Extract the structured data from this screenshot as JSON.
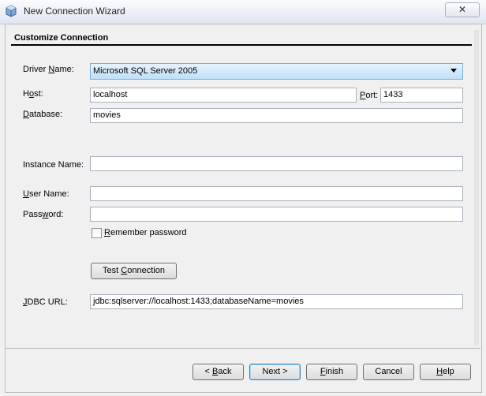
{
  "window": {
    "title": "New Connection Wizard",
    "close_symbol": "✕"
  },
  "section": {
    "title": "Customize Connection"
  },
  "form": {
    "driver": {
      "label_pre": "Driver ",
      "label_ul": "N",
      "label_post": "ame:",
      "value": "Microsoft SQL Server 2005"
    },
    "host": {
      "label_pre": "H",
      "label_ul": "o",
      "label_post": "st:",
      "value": "localhost"
    },
    "port": {
      "label_pre": "",
      "label_ul": "P",
      "label_post": "ort:",
      "value": "1433"
    },
    "database": {
      "label_pre": "",
      "label_ul": "D",
      "label_post": "atabase:",
      "value": "movies"
    },
    "instance": {
      "label": "Instance Name:",
      "value": ""
    },
    "user": {
      "label_pre": "",
      "label_ul": "U",
      "label_post": "ser Name:",
      "value": ""
    },
    "password": {
      "label_pre": "Pass",
      "label_ul": "w",
      "label_post": "ord:",
      "value": ""
    },
    "remember": {
      "label_pre": "",
      "label_ul": "R",
      "label_post": "emember password",
      "checked": false
    },
    "test_button": {
      "label_pre": "Test ",
      "label_ul": "C",
      "label_post": "onnection"
    },
    "jdbc": {
      "label_pre": "",
      "label_ul": "J",
      "label_post": "DBC URL:",
      "value": "jdbc:sqlserver://localhost:1433;databaseName=movies"
    }
  },
  "footer": {
    "back": {
      "label_pre": "< ",
      "label_ul": "B",
      "label_post": "ack"
    },
    "next": {
      "label": "Next >"
    },
    "finish": {
      "label_pre": "",
      "label_ul": "F",
      "label_post": "inish"
    },
    "cancel": {
      "label": "Cancel"
    },
    "help": {
      "label_pre": "",
      "label_ul": "H",
      "label_post": "elp"
    }
  }
}
